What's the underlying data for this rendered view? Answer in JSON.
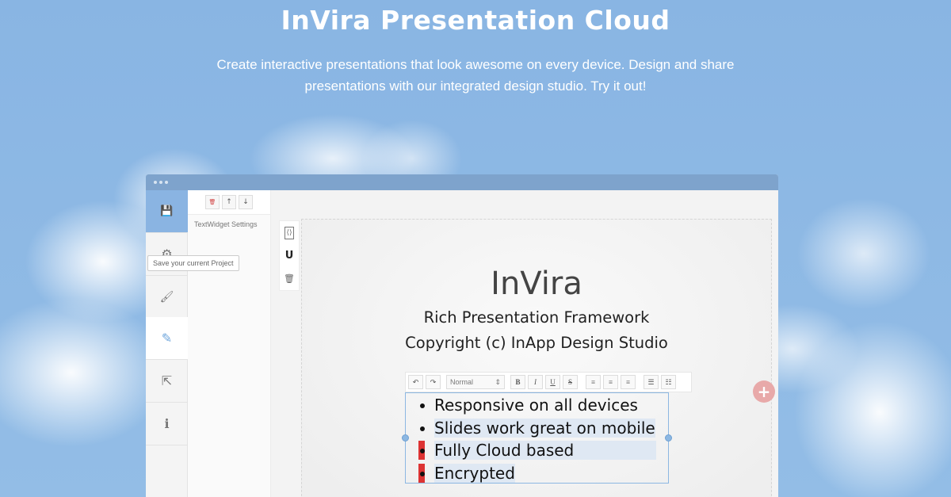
{
  "hero": {
    "title": "InVira Presentation Cloud",
    "subtitle": "Create interactive presentations that look awesome on every device. Design and share presentations with our integrated design studio. Try it out!"
  },
  "sidebar": {
    "tooltip": "Save your current Project",
    "items": [
      {
        "icon": "save-icon",
        "glyph": "💾"
      },
      {
        "icon": "settings-icon",
        "glyph": "⚙"
      },
      {
        "icon": "brush-icon",
        "glyph": "🖌"
      },
      {
        "icon": "edit-icon",
        "glyph": "✎"
      },
      {
        "icon": "share-icon",
        "glyph": "⇱"
      },
      {
        "icon": "info-icon",
        "glyph": "ℹ"
      }
    ]
  },
  "settings_panel": {
    "label": "TextWidget Settings",
    "buttons": [
      {
        "icon": "delete-icon",
        "glyph": "🗑"
      },
      {
        "icon": "arrow-up-icon",
        "glyph": "↑"
      },
      {
        "icon": "arrow-down-icon",
        "glyph": "↓"
      }
    ]
  },
  "tool_column": [
    {
      "icon": "code-file-icon",
      "glyph": "⟨⟩"
    },
    {
      "icon": "magnet-icon",
      "glyph": "U"
    },
    {
      "icon": "trash-icon",
      "glyph": "🗑"
    }
  ],
  "slide": {
    "title": "InVira",
    "line1": "Rich Presentation Framework",
    "line2": "Copyright (c) InApp Design Studio"
  },
  "editor_toolbar": {
    "undo": "↶",
    "redo": "↷",
    "format_value": "Normal",
    "bold": "B",
    "italic": "I",
    "underline": "U",
    "strike": "S",
    "align_left": "≡",
    "align_center": "≡",
    "align_right": "≡",
    "bullet_list": "☰",
    "ordered_list": "☷"
  },
  "bullets": [
    "Responsive on all devices",
    "Slides work great on mobile",
    "Fully Cloud based",
    "Encrypted"
  ],
  "add_button": "+",
  "colors": {
    "accent": "#8ab4e2",
    "sky": "#8fb8e4",
    "highlight_red": "#dd3333",
    "add_button": "#e8a9a9"
  }
}
